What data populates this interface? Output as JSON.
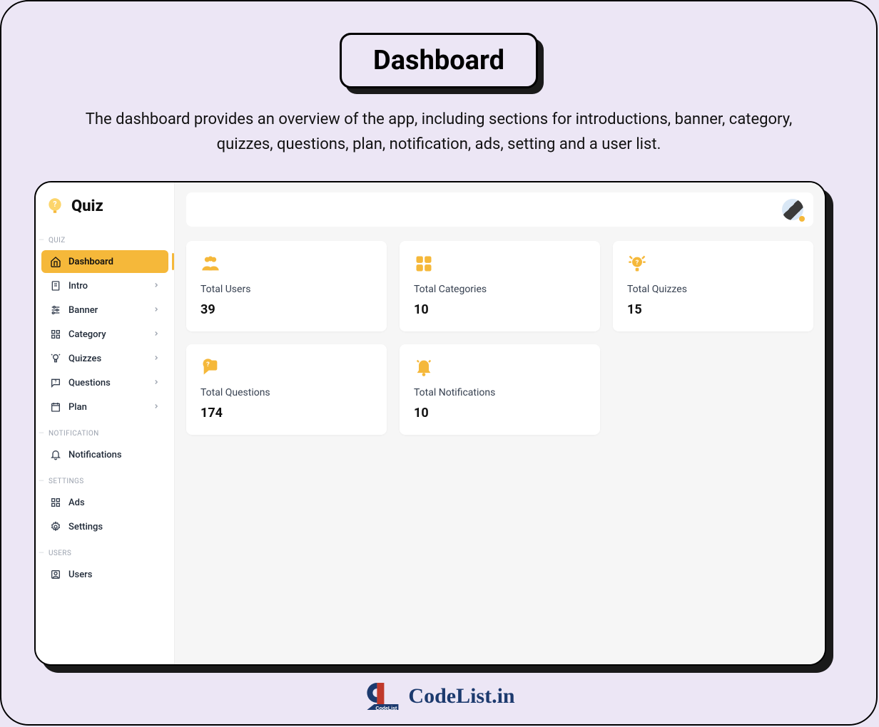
{
  "page": {
    "title": "Dashboard",
    "subtitle": "The dashboard provides an overview of the app, including sections for introductions, banner, category, quizzes, questions, plan, notification, ads, setting and a user list."
  },
  "app": {
    "brand": "Quiz"
  },
  "sections": {
    "quiz": "QUIZ",
    "notification": "NOTIFICATION",
    "settings": "SETTINGS",
    "users": "USERS"
  },
  "nav": {
    "dashboard": "Dashboard",
    "intro": "Intro",
    "banner": "Banner",
    "category": "Category",
    "quizzes": "Quizzes",
    "questions": "Questions",
    "plan": "Plan",
    "notifications": "Notifications",
    "ads": "Ads",
    "settings": "Settings",
    "users": "Users"
  },
  "stats": {
    "users": {
      "label": "Total Users",
      "value": "39"
    },
    "categories": {
      "label": "Total Categories",
      "value": "10"
    },
    "quizzes": {
      "label": "Total Quizzes",
      "value": "15"
    },
    "questions": {
      "label": "Total Questions",
      "value": "174"
    },
    "notifications": {
      "label": "Total Notifications",
      "value": "10"
    }
  },
  "watermark": {
    "text": "CodeList.in",
    "sub": "CodeList"
  }
}
